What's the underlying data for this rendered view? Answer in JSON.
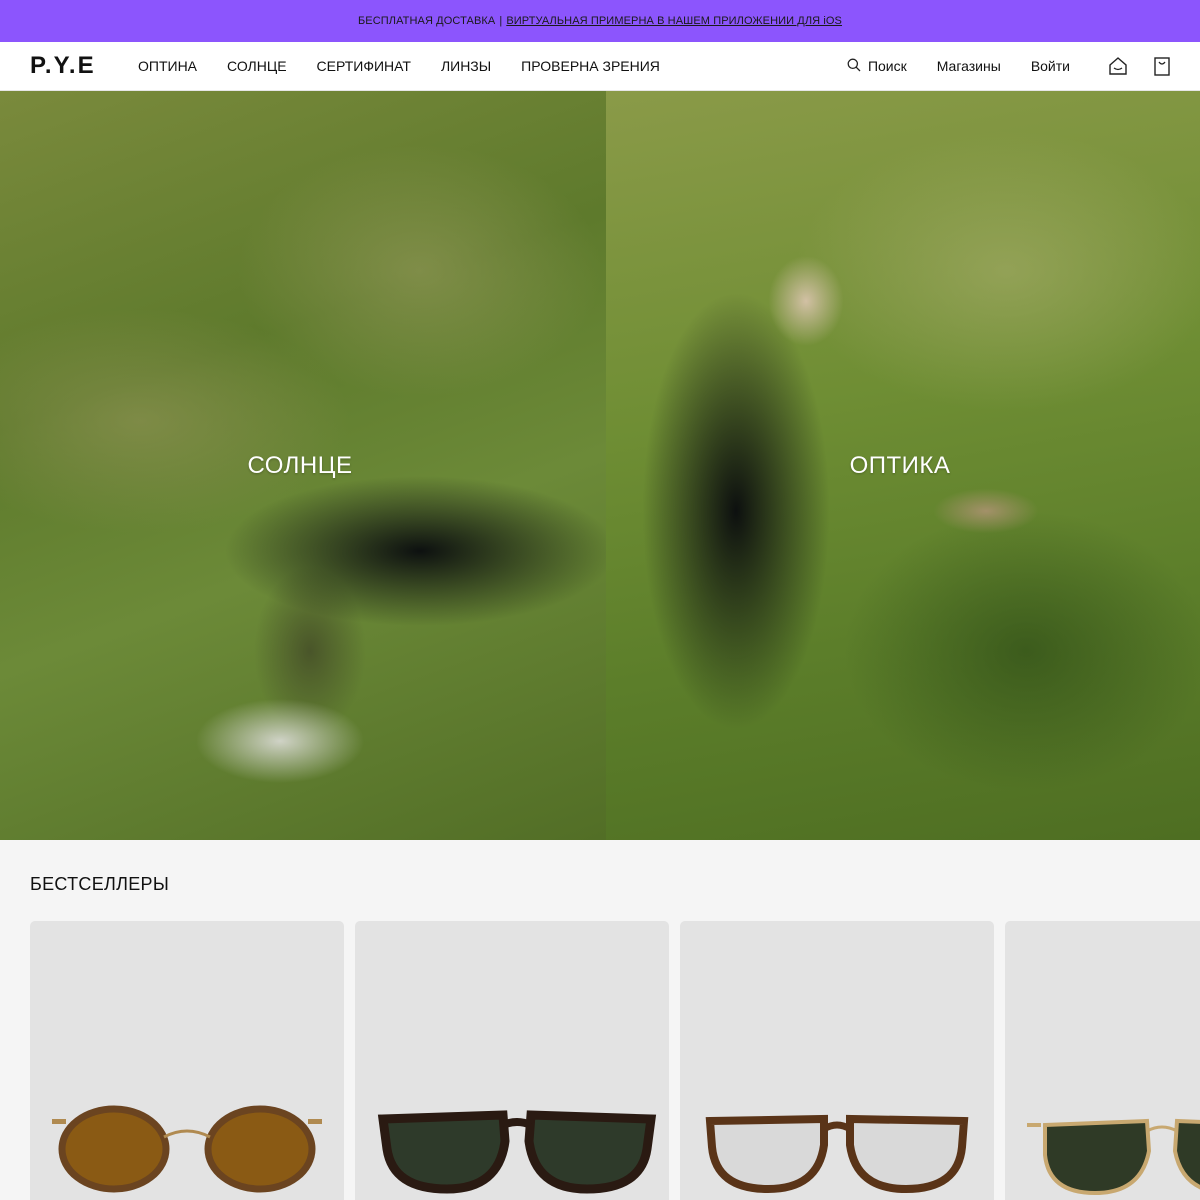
{
  "promo": {
    "text": "БЕСПЛАТНАЯ ДОСТАВКА",
    "separator": "|",
    "link": "ВИРТУАЛЬНАЯ ПРИМЕРНА В НАШЕМ ПРИЛОЖЕНИИ ДЛЯ iOS",
    "bg_color": "#8c55fd"
  },
  "header": {
    "logo": "P.Y.E",
    "nav": [
      "ОПТИНА",
      "СОЛНЦЕ",
      "СЕРТИФИНАТ",
      "ЛИНЗЫ",
      "ПРОВЕРНА ЗРЕНИЯ"
    ],
    "search_label": "Поиск",
    "stores_label": "Магазины",
    "login_label": "Войти",
    "icons": [
      "search-icon",
      "home-icon",
      "cart-icon"
    ]
  },
  "hero": {
    "left_label": "СОЛНЦЕ",
    "right_label": "ОПТИКА"
  },
  "bestsellers": {
    "title": "БЕСТСЕЛЛЕРЫ",
    "products": [
      {
        "icon": "round-tortoise-sunglasses",
        "lens_color": "#8a5a14",
        "frame_color": "#6b4420"
      },
      {
        "icon": "square-dark-sunglasses",
        "lens_color": "#2e3a2a",
        "frame_color": "#2a1a12"
      },
      {
        "icon": "round-tortoise-eyeglasses",
        "lens_color": "transparent",
        "frame_color": "#5a3418"
      },
      {
        "icon": "metal-green-sunglasses",
        "lens_color": "#2f3a26",
        "frame_color": "#c8a870"
      }
    ]
  }
}
